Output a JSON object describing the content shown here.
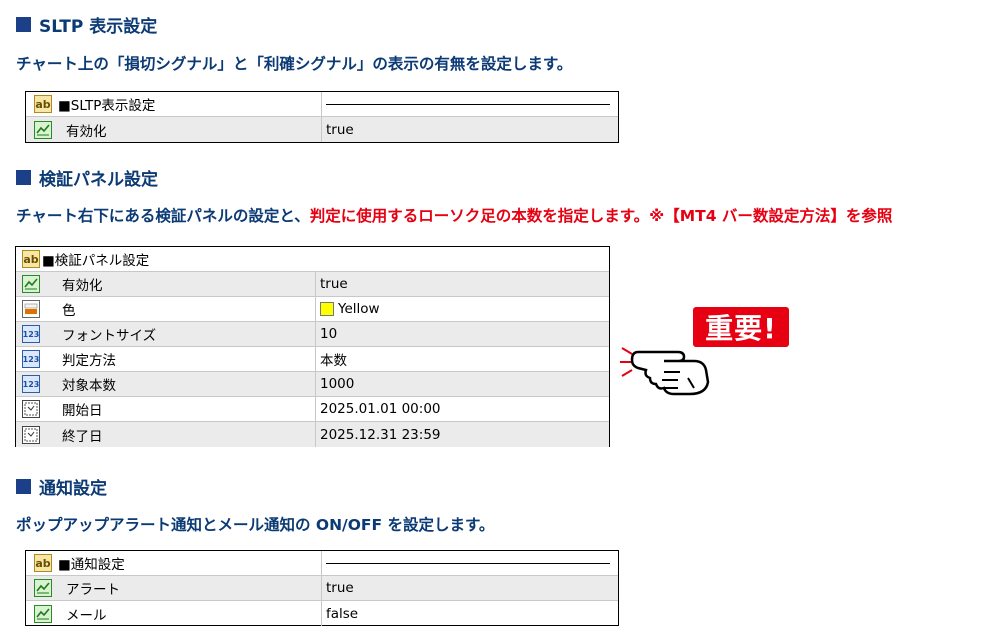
{
  "sections": [
    {
      "title": "SLTP 表示設定",
      "description": "チャート上の「損切シグナル」と「利確シグナル」の表示の有無を設定します。",
      "table": {
        "header": "■SLTP表示設定",
        "rows": [
          {
            "icon": "bool-icon",
            "name": "有効化",
            "value": "true"
          }
        ]
      }
    },
    {
      "title": "検証パネル設定",
      "description": "チャート右下にある検証パネルの設定と、",
      "description_highlight": "判定に使用するローソク足の本数を指定します。※【MT4 バー数設定方法】を参照",
      "table": {
        "header": "■検証パネル設定",
        "rows": [
          {
            "icon": "bool-icon",
            "name": "有効化",
            "value": "true"
          },
          {
            "icon": "color-icon",
            "name": "色",
            "value": "Yellow",
            "swatch": "#ffff00"
          },
          {
            "icon": "number-icon",
            "name": "フォントサイズ",
            "value": "10"
          },
          {
            "icon": "number-icon",
            "name": "判定方法",
            "value": "本数"
          },
          {
            "icon": "number-icon",
            "name": "対象本数",
            "value": "1000"
          },
          {
            "icon": "datetime-icon",
            "name": "開始日",
            "value": "2025.01.01 00:00"
          },
          {
            "icon": "datetime-icon",
            "name": "終了日",
            "value": "2025.12.31 23:59"
          }
        ]
      }
    },
    {
      "title": "通知設定",
      "description": "ポップアップアラート通知とメール通知の ON/OFF を設定します。",
      "table": {
        "header": "■通知設定",
        "rows": [
          {
            "icon": "bool-icon",
            "name": "アラート",
            "value": "true"
          },
          {
            "icon": "bool-icon",
            "name": "メール",
            "value": "false"
          }
        ]
      }
    }
  ],
  "badge": {
    "text": "重要!"
  },
  "colors": {
    "heading": "#0b3a75",
    "highlight": "#e60012",
    "row_alt": "#ebebeb"
  },
  "icon_text": {
    "string": "ab",
    "number": "123"
  }
}
